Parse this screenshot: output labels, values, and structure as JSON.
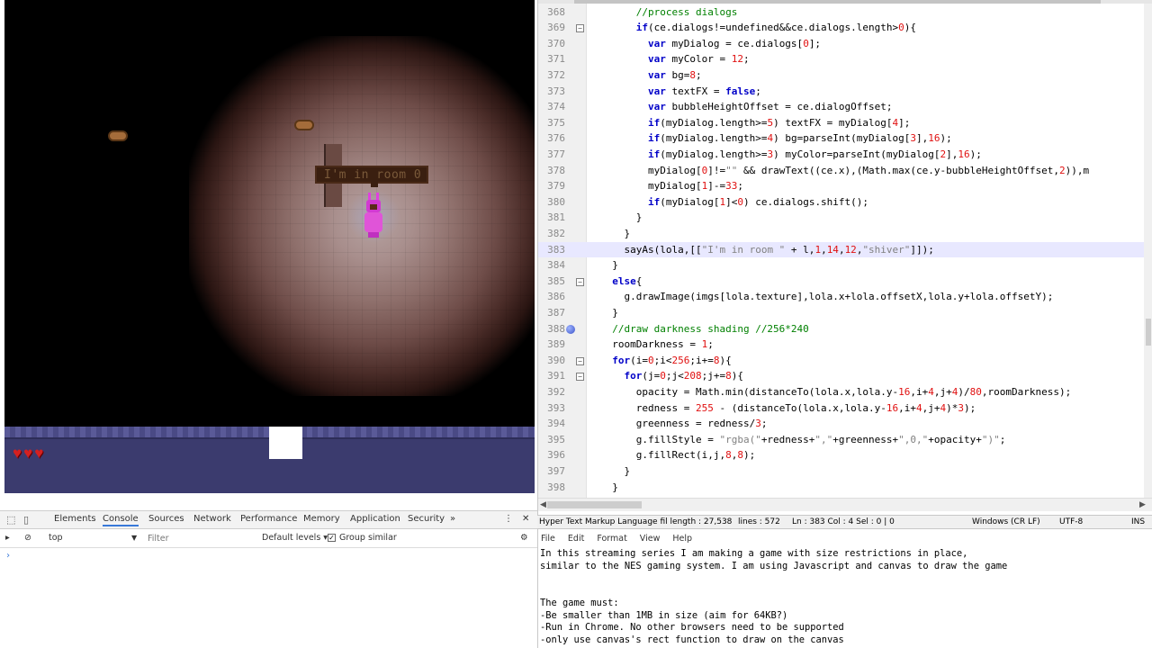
{
  "game": {
    "speech_text": "I'm in room 0",
    "hearts": [
      "♥",
      "♥",
      "♥"
    ]
  },
  "devtools": {
    "tabs": [
      "Elements",
      "Console",
      "Sources",
      "Network",
      "Performance",
      "Memory",
      "Application",
      "Security"
    ],
    "more_tabs_icon": "»",
    "menu_icon": "⋮",
    "close_icon": "✕",
    "context": "top",
    "filter_placeholder": "Filter",
    "levels_label": "Default levels ▾",
    "group_similar_label": "Group similar",
    "prompt": "›"
  },
  "editor": {
    "lines": [
      {
        "n": "368",
        "html": "      <span class=\"c\">//process dialogs</span>"
      },
      {
        "n": "369",
        "html": "      <span class=\"k\">if</span>(ce.dialogs!=undefined&amp;&amp;ce.dialogs.length&gt;<span class=\"n\">0</span>){",
        "fold": true
      },
      {
        "n": "370",
        "html": "        <span class=\"k\">var</span> myDialog = ce.dialogs[<span class=\"n\">0</span>];"
      },
      {
        "n": "371",
        "html": "        <span class=\"k\">var</span> myColor = <span class=\"n\">12</span>;"
      },
      {
        "n": "372",
        "html": "        <span class=\"k\">var</span> bg=<span class=\"n\">8</span>;"
      },
      {
        "n": "373",
        "html": "        <span class=\"k\">var</span> textFX = <span class=\"k\">false</span>;"
      },
      {
        "n": "374",
        "html": "        <span class=\"k\">var</span> bubbleHeightOffset = ce.dialogOffset;"
      },
      {
        "n": "375",
        "html": "        <span class=\"k\">if</span>(myDialog.length&gt;=<span class=\"n\">5</span>) textFX = myDialog[<span class=\"n\">4</span>];"
      },
      {
        "n": "376",
        "html": "        <span class=\"k\">if</span>(myDialog.length&gt;=<span class=\"n\">4</span>) bg=parseInt(myDialog[<span class=\"n\">3</span>],<span class=\"n\">16</span>);"
      },
      {
        "n": "377",
        "html": "        <span class=\"k\">if</span>(myDialog.length&gt;=<span class=\"n\">3</span>) myColor=parseInt(myDialog[<span class=\"n\">2</span>],<span class=\"n\">16</span>);"
      },
      {
        "n": "378",
        "html": "        myDialog[<span class=\"n\">0</span>]!=<span class=\"s\">\"\"</span> &amp;&amp; drawText((ce.x),(Math.max(ce.y-bubbleHeightOffset,<span class=\"n\">2</span>)),m"
      },
      {
        "n": "379",
        "html": "        myDialog[<span class=\"n\">1</span>]-=<span class=\"n\">33</span>;"
      },
      {
        "n": "380",
        "html": "        <span class=\"k\">if</span>(myDialog[<span class=\"n\">1</span>]&lt;<span class=\"n\">0</span>) ce.dialogs.shift();"
      },
      {
        "n": "381",
        "html": "      }"
      },
      {
        "n": "382",
        "html": "    }"
      },
      {
        "n": "383",
        "html": "    sayAs(lola,[[<span class=\"s\">\"I'm in room \"</span> + l,<span class=\"n\">1</span>,<span class=\"n\">14</span>,<span class=\"n\">12</span>,<span class=\"s\">\"shiver\"</span>]]);",
        "current": true
      },
      {
        "n": "384",
        "html": "  }"
      },
      {
        "n": "385",
        "html": "  <span class=\"k\">else</span>{",
        "fold": true
      },
      {
        "n": "386",
        "html": "    g.drawImage(imgs[lola.texture],lola.x+lola.offsetX,lola.y+lola.offsetY);"
      },
      {
        "n": "387",
        "html": "  }"
      },
      {
        "n": "388",
        "html": "  <span class=\"c\">//draw darkness shading //256*240</span>",
        "bp": true
      },
      {
        "n": "389",
        "html": "  roomDarkness = <span class=\"n\">1</span>;"
      },
      {
        "n": "390",
        "html": "  <span class=\"k\">for</span>(i=<span class=\"n\">0</span>;i&lt;<span class=\"n\">256</span>;i+=<span class=\"n\">8</span>){",
        "fold": true
      },
      {
        "n": "391",
        "html": "    <span class=\"k\">for</span>(j=<span class=\"n\">0</span>;j&lt;<span class=\"n\">208</span>;j+=<span class=\"n\">8</span>){",
        "fold": true
      },
      {
        "n": "392",
        "html": "      opacity = Math.min(distanceTo(lola.x,lola.y-<span class=\"n\">16</span>,i+<span class=\"n\">4</span>,j+<span class=\"n\">4</span>)/<span class=\"n\">80</span>,roomDarkness);"
      },
      {
        "n": "393",
        "html": "      redness = <span class=\"n\">255</span> - (distanceTo(lola.x,lola.y-<span class=\"n\">16</span>,i+<span class=\"n\">4</span>,j+<span class=\"n\">4</span>)*<span class=\"n\">3</span>);"
      },
      {
        "n": "394",
        "html": "      greenness = redness/<span class=\"n\">3</span>;"
      },
      {
        "n": "395",
        "html": "      g.fillStyle = <span class=\"s\">\"rgba(\"</span>+redness+<span class=\"s\">\",\"</span>+greenness+<span class=\"s\">\",0,\"</span>+opacity+<span class=\"s\">\")\"</span>;"
      },
      {
        "n": "396",
        "html": "      g.fillRect(i,j,<span class=\"n\">8</span>,<span class=\"n\">8</span>);"
      },
      {
        "n": "397",
        "html": "    }"
      },
      {
        "n": "398",
        "html": "  }"
      }
    ]
  },
  "statusbar": {
    "language": "Hyper Text Markup Language fil length : 27,538",
    "lines": "lines : 572",
    "position": "Ln : 383   Col : 4   Sel : 0 | 0",
    "eol": "Windows (CR LF)",
    "encoding": "UTF-8",
    "mode": "INS"
  },
  "notepad": {
    "menu": [
      "File",
      "Edit",
      "Format",
      "View",
      "Help"
    ],
    "text": "In this streaming series I am making a game with size restrictions in place,\nsimilar to the NES gaming system. I am using Javascript and canvas to draw the game\n\n\nThe game must:\n-Be smaller than 1MB in size (aim for 64KB?)\n-Run in Chrome. No other browsers need to be supported\n-only use canvas's rect function to draw on the canvas"
  },
  "colors": {
    "hud": "#3b3b6e",
    "player": "#e054d8",
    "keyword": "#0000c8",
    "comment": "#008000",
    "number": "#e01010",
    "string": "#808080"
  }
}
